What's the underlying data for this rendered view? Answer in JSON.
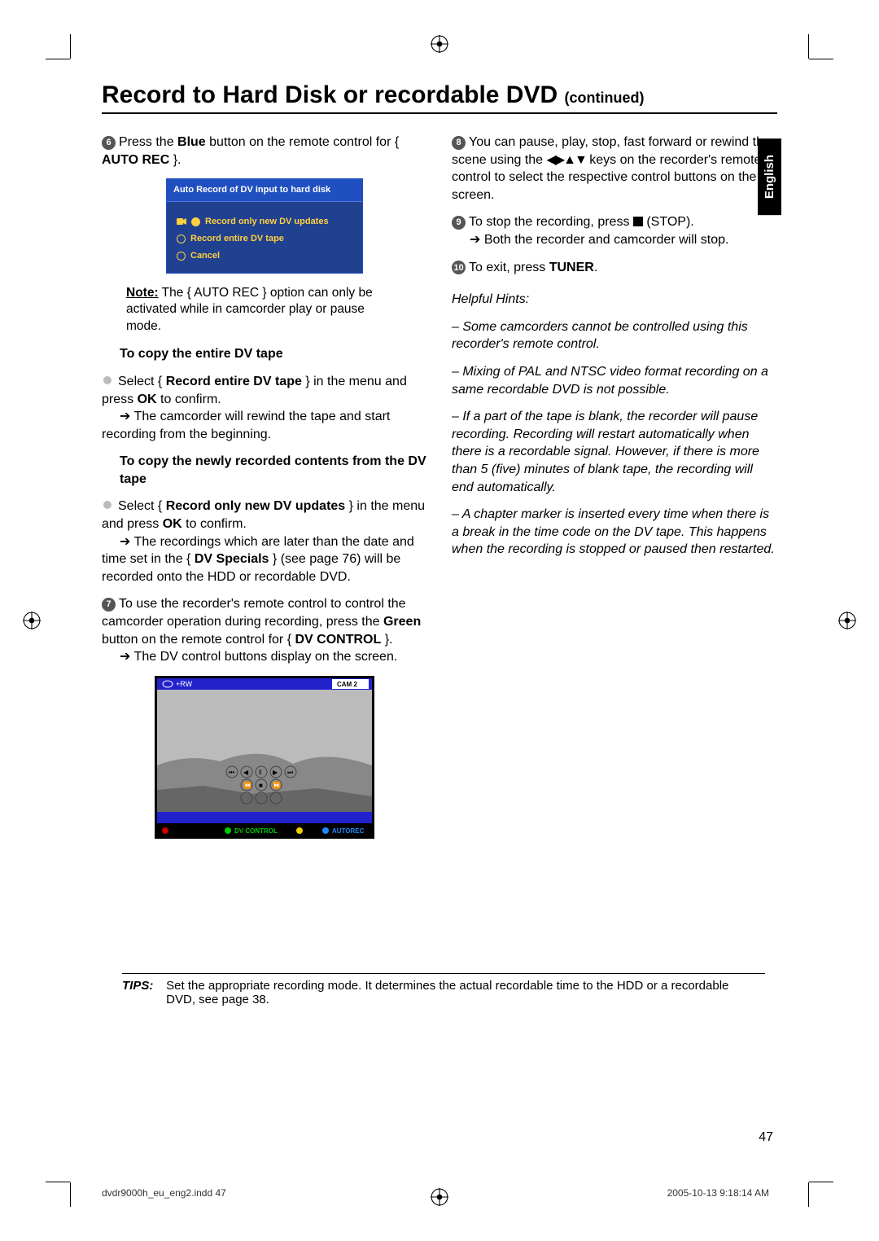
{
  "title": "Record to Hard Disk or recordable DVD",
  "title_cont": "(continued)",
  "lang_tab": "English",
  "left": {
    "step6": {
      "num": "6",
      "text_a": "Press the ",
      "blue": "Blue",
      "text_b": " button on the remote control for { ",
      "bold": "AUTO REC",
      "text_c": " }."
    },
    "dialog": {
      "title": "Auto Record of DV input to hard disk",
      "opt1": "Record only new DV updates",
      "opt2": "Record entire DV tape",
      "opt3": "Cancel"
    },
    "note": {
      "label": "Note:",
      "body": "  The { AUTO REC } option can only be activated while in camcorder play or pause mode."
    },
    "sub1": "To copy the entire DV tape",
    "sub1_body": {
      "a": "Select { ",
      "b": "Record entire DV tape",
      "c": " } in the menu and press ",
      "d": "OK",
      "e": " to confirm."
    },
    "sub1_result": " The camcorder will rewind the tape and start recording from the beginning.",
    "sub2": "To copy the newly recorded contents from the DV tape",
    "sub2_body": {
      "a": "Select { ",
      "b": "Record only new DV updates",
      "c": " } in the menu and press ",
      "d": "OK",
      "e": " to confirm."
    },
    "sub2_result_a": " The recordings which are later than the date and time set in the { ",
    "sub2_result_bold": "DV Specials",
    "sub2_result_b": " } (see page 76) will be recorded onto the HDD or recordable DVD.",
    "step7": {
      "num": "7",
      "a": "To use the recorder's remote control to control the camcorder operation during recording, press the ",
      "b": "Green",
      "c": " button on the remote control for { ",
      "d": "DV CONTROL",
      "e": " }."
    },
    "step7_result": " The DV control buttons display on the screen.",
    "screenshot": {
      "topleft": "+RW",
      "topright": "CAM 2",
      "dvcontrol": "DV CONTROL",
      "autorec": "AUTOREC"
    }
  },
  "right": {
    "step8": {
      "num": "8",
      "a": "You can pause, play, stop, fast forward or rewind the scene using the ",
      "b": " keys on the recorder's remote control to select the respective control buttons on the screen."
    },
    "step9": {
      "num": "9",
      "a": "To stop the recording, press ",
      "b": " (STOP)."
    },
    "step9_result": " Both the recorder and camcorder will stop.",
    "step10": {
      "num": "10",
      "a": "To exit, press ",
      "b": "TUNER",
      "c": "."
    },
    "hints_label": "Helpful Hints:",
    "hint1": "–  Some camcorders cannot be controlled using this recorder's remote control.",
    "hint2": "–  Mixing of PAL and NTSC video format recording on a same recordable DVD is not possible.",
    "hint3": "–  If a part of the tape is blank, the recorder will pause recording. Recording will restart automatically when there is a recordable signal. However, if there is more than 5 (five) minutes of blank tape, the recording will end automatically.",
    "hint4": "–  A chapter marker is inserted every time when there is a break in the time code on the DV tape. This happens when the recording is stopped or paused then restarted."
  },
  "tips": {
    "label": "TIPS:",
    "body": "Set the appropriate recording mode. It determines the actual recordable time to the HDD or a recordable DVD, see page 38."
  },
  "page_number": "47",
  "footer_left": "dvdr9000h_eu_eng2.indd   47",
  "footer_right": "2005-10-13   9:18:14 AM"
}
